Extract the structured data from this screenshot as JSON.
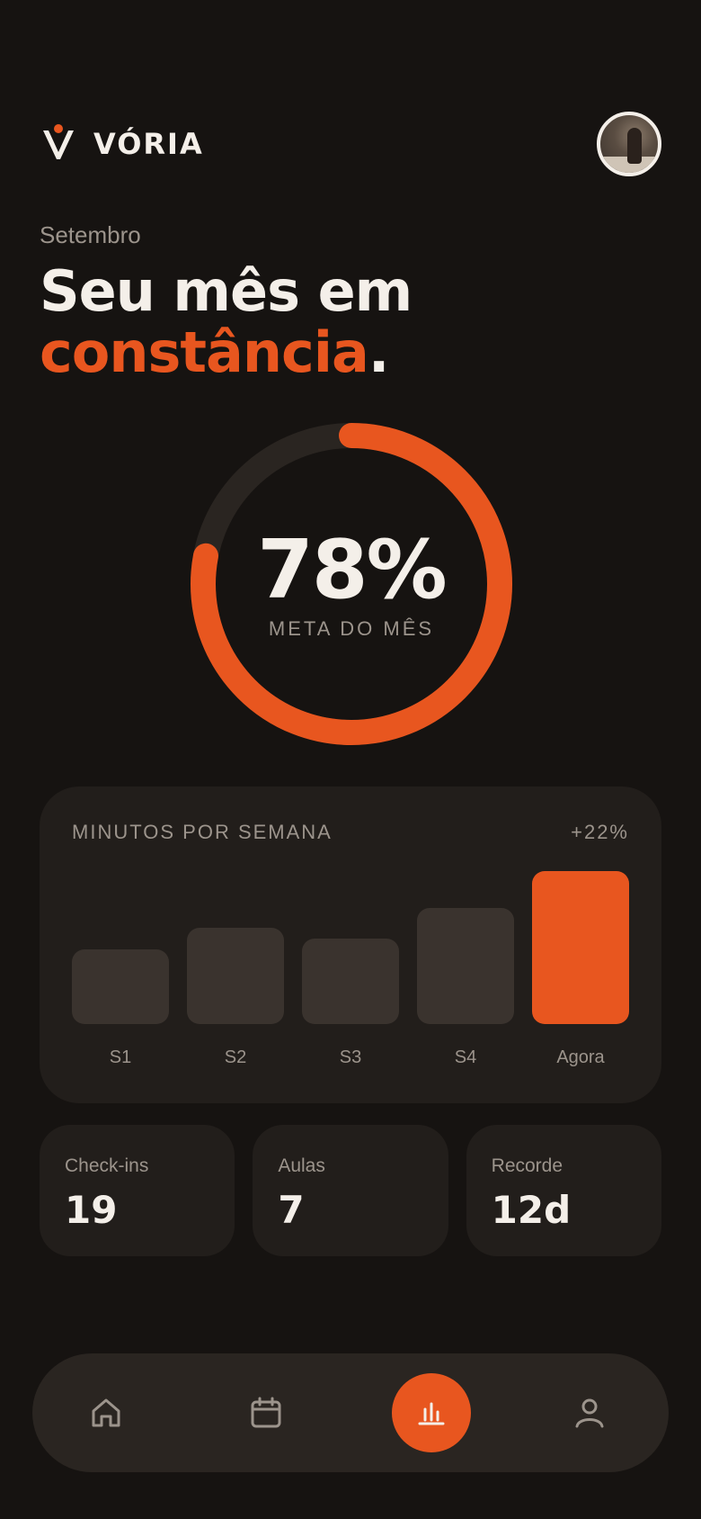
{
  "brand": {
    "name": "VÓRIA",
    "logo_icon": "v-logo-icon",
    "accent": "#e8561f"
  },
  "header": {
    "avatar_icon": "user-avatar"
  },
  "hero": {
    "month": "Setembro",
    "title_line1": "Seu mês em",
    "title_accent": "constância",
    "title_period": "."
  },
  "goal": {
    "value": 78,
    "display": "78%",
    "label": "META DO MÊS"
  },
  "weekly": {
    "title": "MINUTOS POR SEMANA",
    "change": "+22%",
    "chart_data": {
      "type": "bar",
      "categories": [
        "S1",
        "S2",
        "S3",
        "S4",
        "Agora"
      ],
      "values": [
        49,
        63,
        56,
        76,
        100
      ],
      "highlight_index": 4,
      "colors": {
        "default": "#3a332e",
        "highlight": "#e8561f"
      }
    }
  },
  "stats": [
    {
      "label": "Check-ins",
      "value": "19"
    },
    {
      "label": "Aulas",
      "value": "7"
    },
    {
      "label": "Recorde",
      "value": "12d"
    }
  ],
  "nav": {
    "items": [
      {
        "icon": "home-icon",
        "active": false
      },
      {
        "icon": "calendar-icon",
        "active": false
      },
      {
        "icon": "bar-chart-icon",
        "active": true
      },
      {
        "icon": "profile-icon",
        "active": false
      }
    ]
  }
}
